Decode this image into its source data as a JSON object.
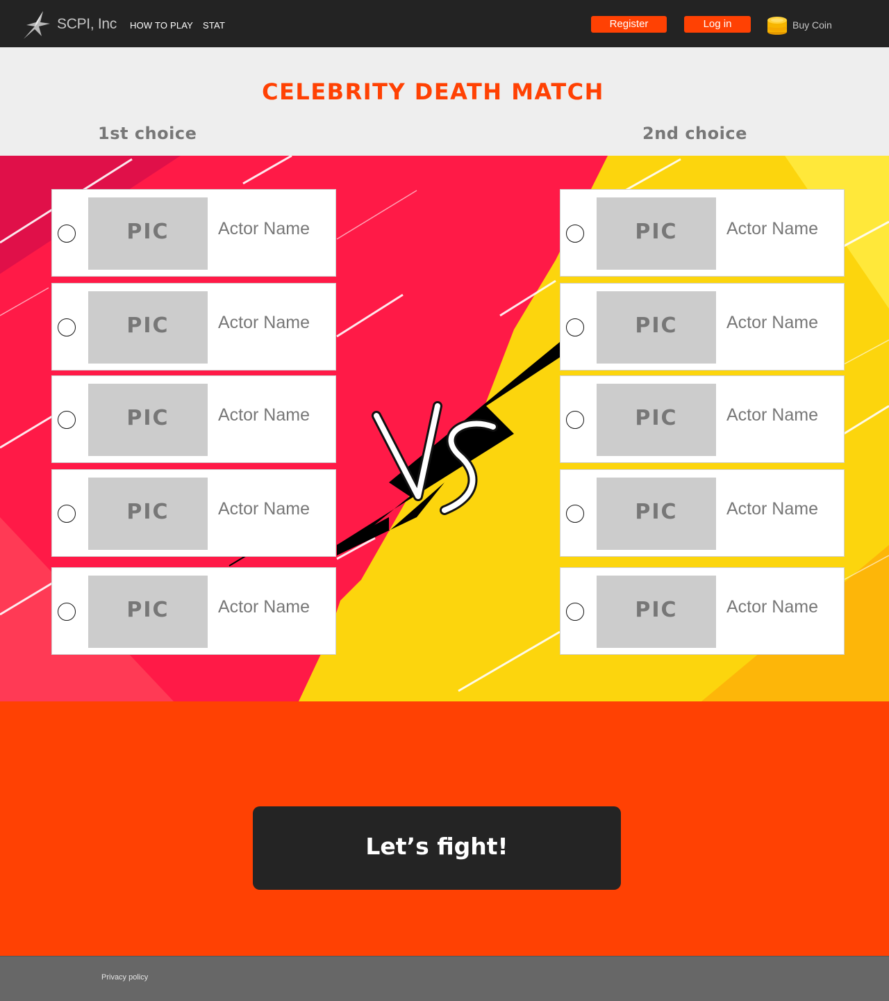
{
  "header": {
    "brand": "SCPI, Inc",
    "nav": [
      {
        "label": "HOW TO PLAY"
      },
      {
        "label": "STAT"
      }
    ],
    "register_label": "Register",
    "login_label": "Log in",
    "buy_coin_label": "Buy Coin"
  },
  "page": {
    "title": "CELEBRITY DEATH MATCH",
    "first_choice": "1st choice",
    "second_choice": "2nd choice"
  },
  "left_choices": [
    {
      "pic": "PIC",
      "name": "Actor Name"
    },
    {
      "pic": "PIC",
      "name": "Actor Name"
    },
    {
      "pic": "PIC",
      "name": "Actor Name"
    },
    {
      "pic": "PIC",
      "name": "Actor Name"
    },
    {
      "pic": "PIC",
      "name": "Actor Name"
    }
  ],
  "right_choices": [
    {
      "pic": "PIC",
      "name": "Actor Name"
    },
    {
      "pic": "PIC",
      "name": "Actor Name"
    },
    {
      "pic": "PIC",
      "name": "Actor Name"
    },
    {
      "pic": "PIC",
      "name": "Actor Name"
    },
    {
      "pic": "PIC",
      "name": "Actor Name"
    }
  ],
  "arena": {
    "versus_graphic": "vs-graphic",
    "left_color": "#ff1a47",
    "right_color": "#fcd50d"
  },
  "fight": {
    "button_label": "Let’s fight!"
  },
  "footer": {
    "privacy_label": "Privacy policy"
  },
  "colors": {
    "accent": "#ff4103",
    "header_bg": "#232323",
    "footer_bg": "#676767",
    "title_text": "#ff4103",
    "muted_text": "#777777"
  }
}
